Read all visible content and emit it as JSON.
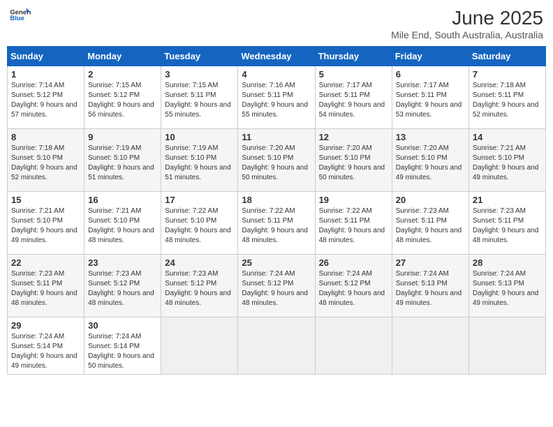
{
  "logo": {
    "text_general": "General",
    "text_blue": "Blue"
  },
  "title": "June 2025",
  "location": "Mile End, South Australia, Australia",
  "weekdays": [
    "Sunday",
    "Monday",
    "Tuesday",
    "Wednesday",
    "Thursday",
    "Friday",
    "Saturday"
  ],
  "weeks": [
    [
      {
        "day": "1",
        "sunrise": "7:14 AM",
        "sunset": "5:12 PM",
        "daylight": "9 hours and 57 minutes."
      },
      {
        "day": "2",
        "sunrise": "7:15 AM",
        "sunset": "5:12 PM",
        "daylight": "9 hours and 56 minutes."
      },
      {
        "day": "3",
        "sunrise": "7:15 AM",
        "sunset": "5:11 PM",
        "daylight": "9 hours and 55 minutes."
      },
      {
        "day": "4",
        "sunrise": "7:16 AM",
        "sunset": "5:11 PM",
        "daylight": "9 hours and 55 minutes."
      },
      {
        "day": "5",
        "sunrise": "7:17 AM",
        "sunset": "5:11 PM",
        "daylight": "9 hours and 54 minutes."
      },
      {
        "day": "6",
        "sunrise": "7:17 AM",
        "sunset": "5:11 PM",
        "daylight": "9 hours and 53 minutes."
      },
      {
        "day": "7",
        "sunrise": "7:18 AM",
        "sunset": "5:11 PM",
        "daylight": "9 hours and 52 minutes."
      }
    ],
    [
      {
        "day": "8",
        "sunrise": "7:18 AM",
        "sunset": "5:10 PM",
        "daylight": "9 hours and 52 minutes."
      },
      {
        "day": "9",
        "sunrise": "7:19 AM",
        "sunset": "5:10 PM",
        "daylight": "9 hours and 51 minutes."
      },
      {
        "day": "10",
        "sunrise": "7:19 AM",
        "sunset": "5:10 PM",
        "daylight": "9 hours and 51 minutes."
      },
      {
        "day": "11",
        "sunrise": "7:20 AM",
        "sunset": "5:10 PM",
        "daylight": "9 hours and 50 minutes."
      },
      {
        "day": "12",
        "sunrise": "7:20 AM",
        "sunset": "5:10 PM",
        "daylight": "9 hours and 50 minutes."
      },
      {
        "day": "13",
        "sunrise": "7:20 AM",
        "sunset": "5:10 PM",
        "daylight": "9 hours and 49 minutes."
      },
      {
        "day": "14",
        "sunrise": "7:21 AM",
        "sunset": "5:10 PM",
        "daylight": "9 hours and 49 minutes."
      }
    ],
    [
      {
        "day": "15",
        "sunrise": "7:21 AM",
        "sunset": "5:10 PM",
        "daylight": "9 hours and 49 minutes."
      },
      {
        "day": "16",
        "sunrise": "7:21 AM",
        "sunset": "5:10 PM",
        "daylight": "9 hours and 48 minutes."
      },
      {
        "day": "17",
        "sunrise": "7:22 AM",
        "sunset": "5:10 PM",
        "daylight": "9 hours and 48 minutes."
      },
      {
        "day": "18",
        "sunrise": "7:22 AM",
        "sunset": "5:11 PM",
        "daylight": "9 hours and 48 minutes."
      },
      {
        "day": "19",
        "sunrise": "7:22 AM",
        "sunset": "5:11 PM",
        "daylight": "9 hours and 48 minutes."
      },
      {
        "day": "20",
        "sunrise": "7:23 AM",
        "sunset": "5:11 PM",
        "daylight": "9 hours and 48 minutes."
      },
      {
        "day": "21",
        "sunrise": "7:23 AM",
        "sunset": "5:11 PM",
        "daylight": "9 hours and 48 minutes."
      }
    ],
    [
      {
        "day": "22",
        "sunrise": "7:23 AM",
        "sunset": "5:11 PM",
        "daylight": "9 hours and 48 minutes."
      },
      {
        "day": "23",
        "sunrise": "7:23 AM",
        "sunset": "5:12 PM",
        "daylight": "9 hours and 48 minutes."
      },
      {
        "day": "24",
        "sunrise": "7:23 AM",
        "sunset": "5:12 PM",
        "daylight": "9 hours and 48 minutes."
      },
      {
        "day": "25",
        "sunrise": "7:24 AM",
        "sunset": "5:12 PM",
        "daylight": "9 hours and 48 minutes."
      },
      {
        "day": "26",
        "sunrise": "7:24 AM",
        "sunset": "5:12 PM",
        "daylight": "9 hours and 48 minutes."
      },
      {
        "day": "27",
        "sunrise": "7:24 AM",
        "sunset": "5:13 PM",
        "daylight": "9 hours and 49 minutes."
      },
      {
        "day": "28",
        "sunrise": "7:24 AM",
        "sunset": "5:13 PM",
        "daylight": "9 hours and 49 minutes."
      }
    ],
    [
      {
        "day": "29",
        "sunrise": "7:24 AM",
        "sunset": "5:14 PM",
        "daylight": "9 hours and 49 minutes."
      },
      {
        "day": "30",
        "sunrise": "7:24 AM",
        "sunset": "5:14 PM",
        "daylight": "9 hours and 50 minutes."
      },
      null,
      null,
      null,
      null,
      null
    ]
  ]
}
